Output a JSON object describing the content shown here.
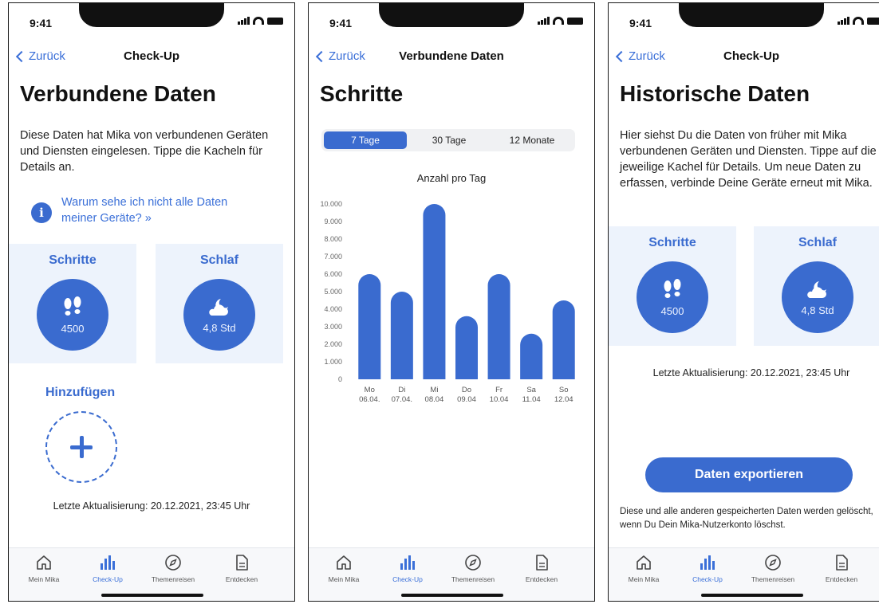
{
  "status": {
    "time": "9:41"
  },
  "tabs": [
    {
      "label": "Mein Mika",
      "icon": "home-icon"
    },
    {
      "label": "Check-Up",
      "icon": "bar-chart-icon"
    },
    {
      "label": "Themenreisen",
      "icon": "compass-icon"
    },
    {
      "label": "Entdecken",
      "icon": "document-icon"
    }
  ],
  "screen1": {
    "back_label": "Zurück",
    "nav_title": "Check-Up",
    "title": "Verbundene Daten",
    "intro": "Diese Daten hat Mika von verbundenen Geräten und Diensten eingelesen. Tippe die Kacheln für Details an.",
    "info_link": "Warum sehe ich nicht alle Daten meiner Geräte? »",
    "tiles": [
      {
        "label": "Schritte",
        "value": "4500",
        "icon": "footprints-icon"
      },
      {
        "label": "Schlaf",
        "value": "4,8 Std",
        "icon": "moon-cloud-icon"
      }
    ],
    "add_label": "Hinzufügen",
    "updated": "Letzte Aktualisierung: 20.12.2021, 23:45 Uhr"
  },
  "screen2": {
    "back_label": "Zurück",
    "nav_title": "Verbundene Daten",
    "title": "Schritte",
    "segments": [
      "7 Tage",
      "30 Tage",
      "12 Monate"
    ],
    "selected_segment": "7 Tage",
    "chart_data": {
      "type": "bar",
      "title": "Anzahl pro Tag",
      "xlabel": "",
      "ylabel": "",
      "categories": [
        {
          "day": "Mo",
          "date": "06.04."
        },
        {
          "day": "Di",
          "date": "07.04."
        },
        {
          "day": "Mi",
          "date": "08.04"
        },
        {
          "day": "Do",
          "date": "09.04"
        },
        {
          "day": "Fr",
          "date": "10.04"
        },
        {
          "day": "Sa",
          "date": "11.04"
        },
        {
          "day": "So",
          "date": "12.04"
        }
      ],
      "values": [
        6000,
        5000,
        10000,
        3600,
        6000,
        2600,
        4500
      ],
      "ylim": [
        0,
        10000
      ],
      "yticks": [
        "0",
        "1.000",
        "2.000",
        "3.000",
        "4.000",
        "5.000",
        "6.000",
        "7.000",
        "8.000",
        "9.000",
        "10.000"
      ],
      "grid": false,
      "bar_color": "#3a6bcf"
    }
  },
  "screen3": {
    "back_label": "Zurück",
    "nav_title": "Check-Up",
    "title": "Historische Daten",
    "intro": "Hier siehst Du die Daten von früher mit Mika verbundenen Geräten und Diensten. Tippe auf die jeweilige Kachel für Details. Um neue Daten zu erfassen, verbinde Deine Geräte erneut mit Mika.",
    "tiles": [
      {
        "label": "Schritte",
        "value": "4500",
        "icon": "footprints-icon"
      },
      {
        "label": "Schlaf",
        "value": "4,8 Std",
        "icon": "moon-cloud-icon"
      }
    ],
    "updated": "Letzte Aktualisierung: 20.12.2021, 23:45 Uhr",
    "export_label": "Daten exportieren",
    "note": "Diese und alle anderen gespeicherten Daten werden gelöscht, wenn Du Dein Mika-Nutzerkonto löschst."
  },
  "colors": {
    "accent": "#3a6bcf",
    "link": "#3a6fd8",
    "tile_bg": "#edf3fc"
  }
}
